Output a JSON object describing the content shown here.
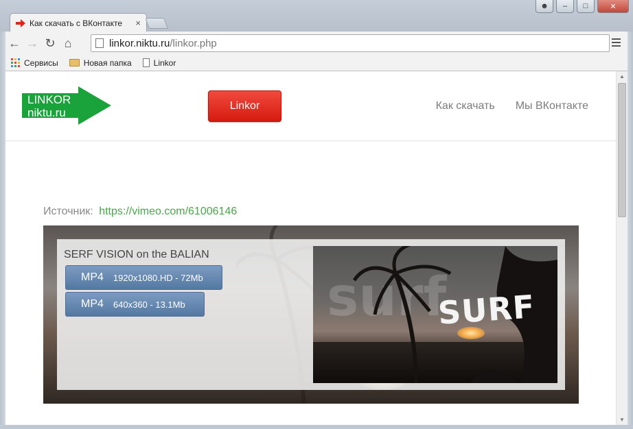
{
  "browser": {
    "tab_title": "Как скачать с ВКонтакте",
    "tab_close": "×",
    "url_host": "linkor.niktu.ru",
    "url_path": "/linkor.php",
    "bookmarks": [
      {
        "label": "Сервисы",
        "icon": "apps-icon"
      },
      {
        "label": "Новая папка",
        "icon": "folder-icon"
      },
      {
        "label": "Linkor",
        "icon": "page-icon"
      }
    ]
  },
  "site": {
    "logo_line1": "LINKOR",
    "logo_line2": "niktu.ru",
    "cta_label": "Linkor",
    "nav": [
      {
        "label": "Как скачать"
      },
      {
        "label": "Мы ВКонтакте"
      }
    ]
  },
  "source": {
    "label": "Источник:",
    "url": "https://vimeo.com/61006146"
  },
  "video": {
    "title": "SERF VISION on the BALIAN",
    "downloads": [
      {
        "format": "MP4",
        "info": "1920x1080.HD - 72Mb"
      },
      {
        "format": "MP4",
        "info": "640x360 - 13.1Mb"
      }
    ],
    "thumbnail_text": "SURF",
    "thumbnail_ghost_text": "surf"
  },
  "colors": {
    "cta": "#e0261b",
    "link": "#46a846",
    "download_button": "#6287b2",
    "logo_green": "#1aa33a"
  }
}
